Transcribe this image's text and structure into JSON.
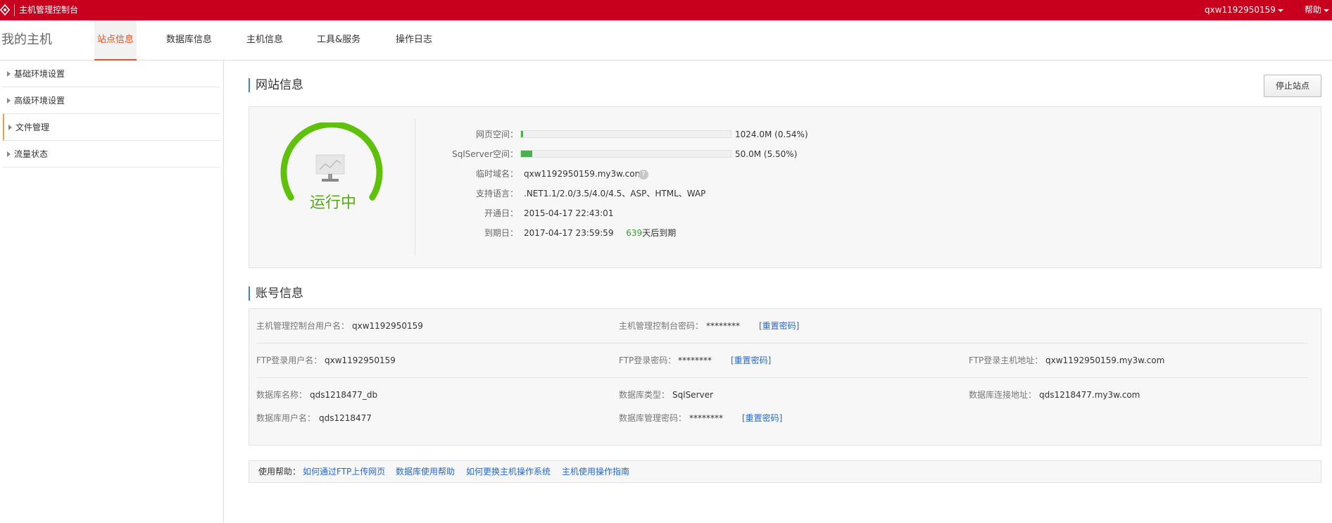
{
  "header": {
    "app_title": "主机管理控制台",
    "user": "qxw1192950159",
    "help": "帮助"
  },
  "nav": {
    "page_title": "我的主机",
    "tabs": [
      {
        "label": "站点信息",
        "active": true
      },
      {
        "label": "数据库信息"
      },
      {
        "label": "主机信息"
      },
      {
        "label": "工具&服务"
      },
      {
        "label": "操作日志"
      }
    ]
  },
  "sidebar": {
    "items": [
      {
        "label": "基础环境设置"
      },
      {
        "label": "高级环境设置"
      },
      {
        "label": "文件管理",
        "active": true
      },
      {
        "label": "流量状态"
      }
    ]
  },
  "site": {
    "title": "网站信息",
    "stop_button": "停止站点",
    "status": "运行中",
    "web_space": {
      "label": "网页空间：",
      "value": "1024.0M (0.54%)",
      "percent": 0.54
    },
    "sql_space": {
      "label": "SqlServer空间：",
      "value": "50.0M (5.50%)",
      "percent": 5.5
    },
    "temp_domain": {
      "label": "临时域名：",
      "value": "qxw1192950159.my3w.com",
      "help": "?"
    },
    "languages": {
      "label": "支持语言：",
      "value": ".NET1.1/2.0/3.5/4.0/4.5、ASP、HTML、WAP"
    },
    "open_date": {
      "label": "开通日：",
      "value": "2015-04-17 22:43:01"
    },
    "expire_date": {
      "label": "到期日：",
      "value": "2017-04-17 23:59:59",
      "days": "639",
      "days_suffix": "天后到期"
    }
  },
  "account": {
    "title": "账号信息",
    "reset_label": "[重置密码]",
    "rows": {
      "panel_user": {
        "label": "主机管理控制台用户名：",
        "value": "qxw1192950159"
      },
      "panel_pwd": {
        "label": "主机管理控制台密码：",
        "value": "********"
      },
      "ftp_user": {
        "label": "FTP登录用户名：",
        "value": "qxw1192950159"
      },
      "ftp_pwd": {
        "label": "FTP登录密码：",
        "value": "********"
      },
      "ftp_host": {
        "label": "FTP登录主机地址：",
        "value": "qxw1192950159.my3w.com"
      },
      "db_name": {
        "label": "数据库名称：",
        "value": "qds1218477_db"
      },
      "db_type": {
        "label": "数据库类型：",
        "value": "SqlServer"
      },
      "db_host": {
        "label": "数据库连接地址：",
        "value": "qds1218477.my3w.com"
      },
      "db_user": {
        "label": "数据库用户名：",
        "value": "qds1218477"
      },
      "db_pwd": {
        "label": "数据库管理密码：",
        "value": "********"
      }
    }
  },
  "help_bar": {
    "label": "使用帮助：",
    "links": [
      "如何通过FTP上传网页",
      "数据库使用帮助",
      "如何更换主机操作系统",
      "主机使用操作指南"
    ]
  },
  "colors": {
    "brand": "#c8001e",
    "accent": "#e8501f",
    "status_green": "#5aa81e",
    "link": "#2a66c8"
  }
}
